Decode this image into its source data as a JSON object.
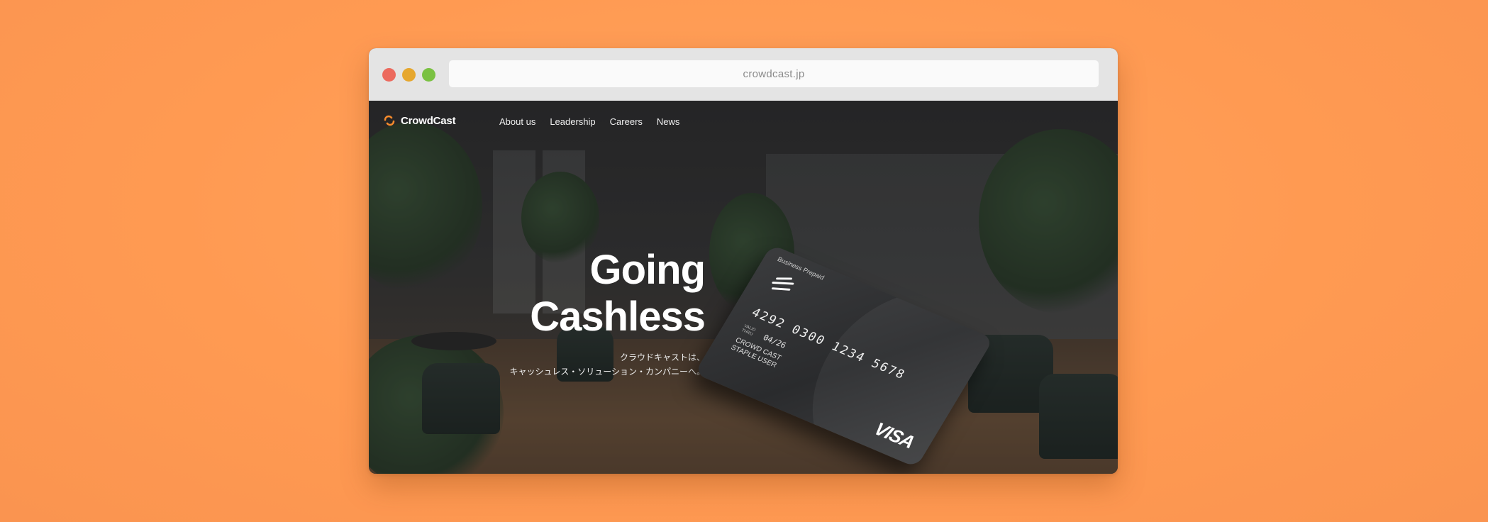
{
  "browser": {
    "url": "crowdcast.jp"
  },
  "nav": {
    "brand": "CrowdCast",
    "links": [
      "About us",
      "Leadership",
      "Careers",
      "News"
    ]
  },
  "hero": {
    "headline_line1": "Going",
    "headline_line2": "Cashless",
    "subcopy_line1": "クラウドキャストは、",
    "subcopy_line2": "キャッシュレス・ソリューション・カンパニーへ。"
  },
  "card": {
    "label": "Business Prepaid",
    "number": "4292 0300 1234 5678",
    "expiry": "04/26",
    "holder_line1": "CROWD CAST",
    "holder_line2": "STAPLE USER",
    "network": "VISA"
  },
  "colors": {
    "background": "#ff9a52",
    "brand_accent": "#f58a2c",
    "window_chrome": "#e4e4e4"
  }
}
